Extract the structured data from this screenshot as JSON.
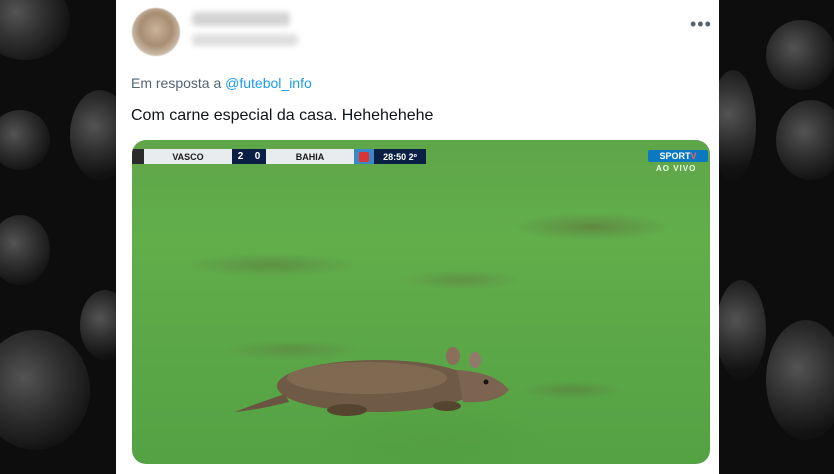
{
  "tweet": {
    "more_icon": "more-horizontal-icon",
    "reply_prefix": "Em resposta a",
    "reply_handle": "@futebol_info",
    "text": "Com carne especial da casa. Hehehehehe",
    "author_name": "",
    "author_handle": ""
  },
  "media": {
    "scoreboard": {
      "home_team": "VASCO",
      "home_score": "2",
      "away_score": "0",
      "away_team": "BAHIA",
      "clock": "28:50",
      "period": "2º"
    },
    "channel": {
      "name_part1": "SPORT",
      "name_part2": "V",
      "live_label": "AO VIVO"
    }
  },
  "colors": {
    "link": "#1d9bf0",
    "text_primary": "#0f1419",
    "text_secondary": "#536471",
    "scoreboard_navy": "#0a1f44",
    "pitch_green": "#5fa54a"
  }
}
